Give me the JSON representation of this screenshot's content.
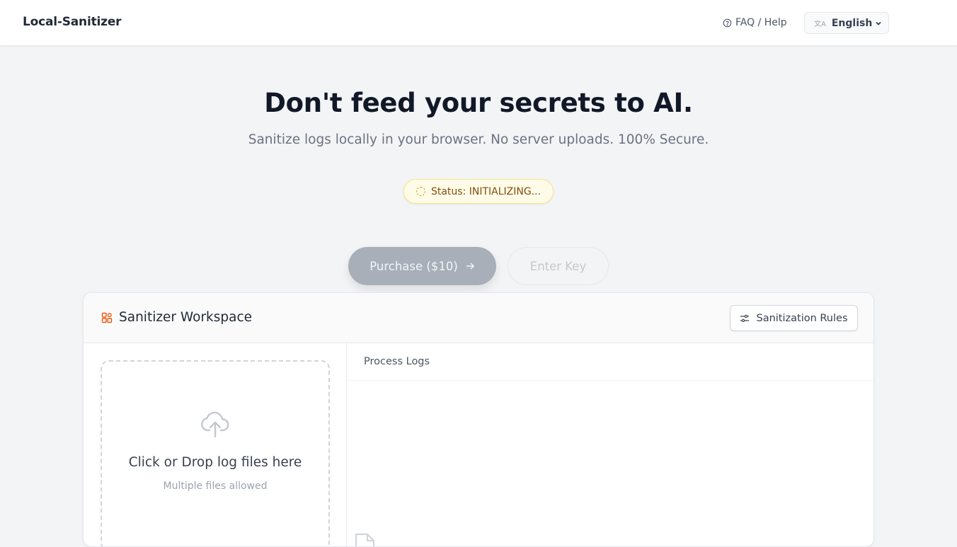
{
  "header": {
    "brand": "Local-Sanitizer",
    "faq_label": "FAQ / Help",
    "language": "English"
  },
  "hero": {
    "title": "Don't feed your secrets to AI.",
    "subtitle": "Sanitize logs locally in your browser. No server uploads. 100% Secure."
  },
  "status": {
    "text": "Status: INITIALIZING..."
  },
  "actions": {
    "purchase_label": "Purchase ($10)",
    "enter_key_label": "Enter Key"
  },
  "workspace": {
    "title": "Sanitizer Workspace",
    "rules_button": "Sanitization Rules",
    "dropzone_title": "Click or Drop log files here",
    "dropzone_hint": "Multiple files allowed",
    "logs_label": "Process Logs"
  },
  "colors": {
    "accent_icon": "#ea580c",
    "status_bg": "#fefce8",
    "status_text": "#854d0e",
    "disabled_button": "#9ca3af"
  },
  "icons": [
    "help-circle-icon",
    "translate-icon",
    "chevron-down-icon",
    "loader-icon",
    "arrow-right-icon",
    "grid-shapes-icon",
    "sliders-icon",
    "upload-cloud-icon",
    "file-icon"
  ]
}
